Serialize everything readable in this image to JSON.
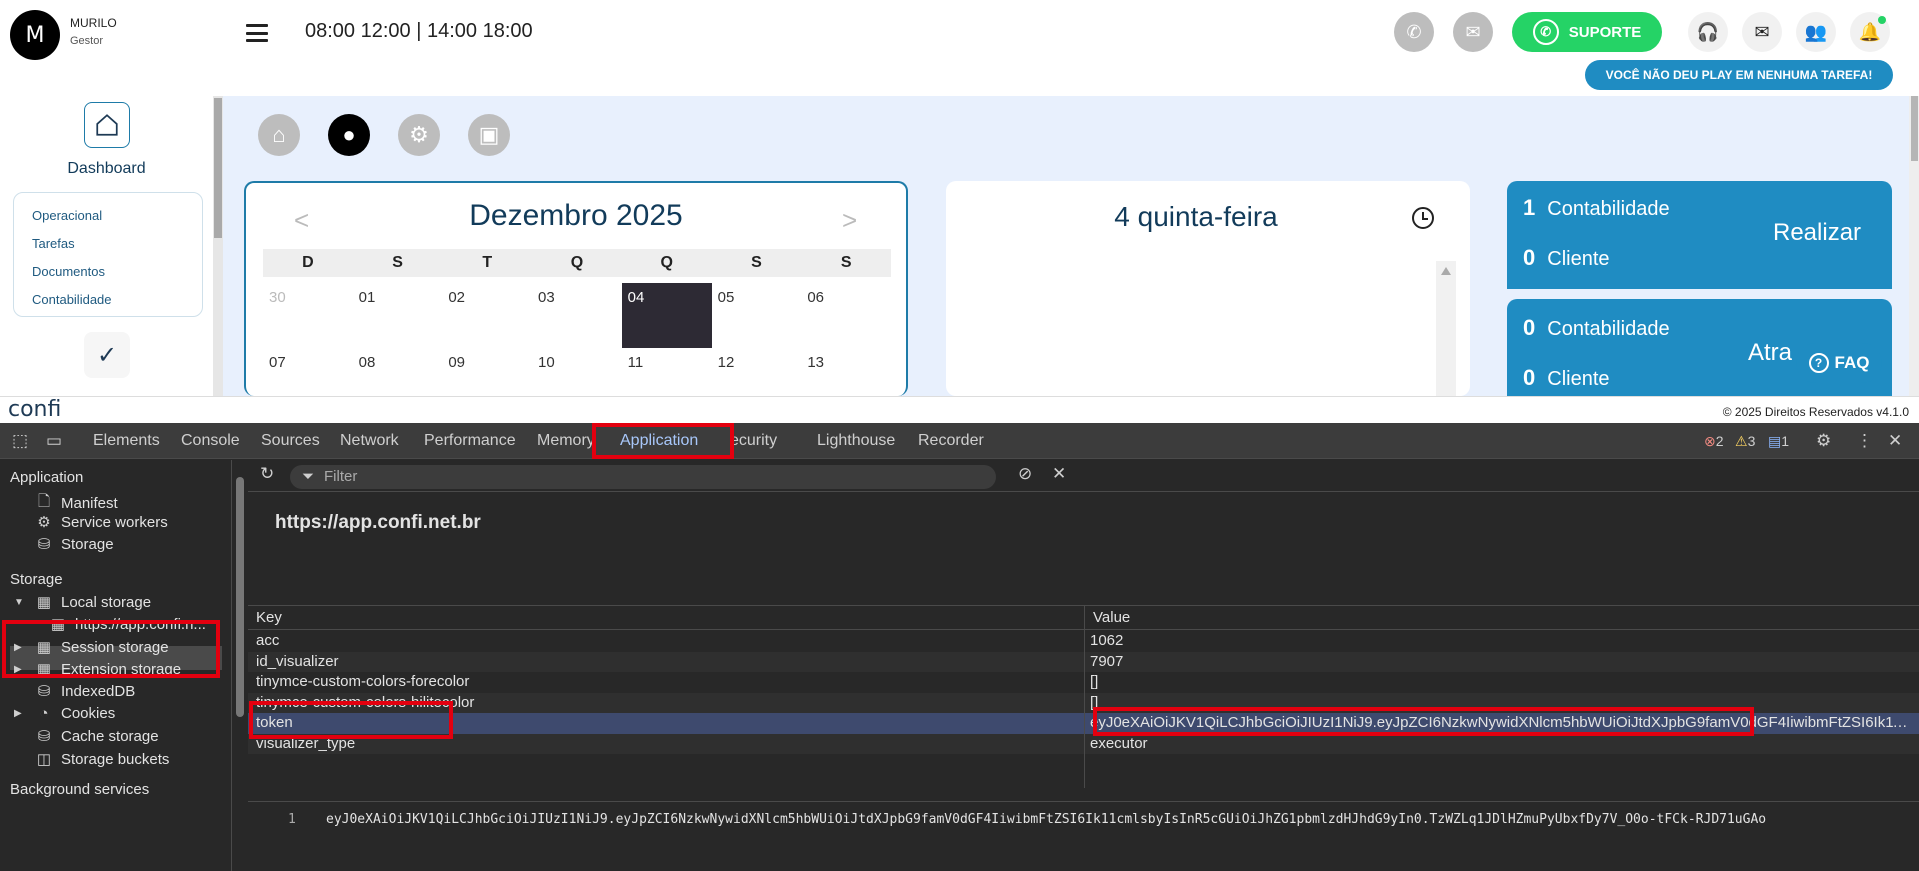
{
  "user": {
    "initial": "M",
    "name": "MURILO",
    "role": "Gestor"
  },
  "header": {
    "hours": "08:00 12:00 | 14:00 18:00",
    "support_label": "SUPORTE",
    "play_badge": "VOCÊ NÃO DEU PLAY EM NENHUMA TAREFA!"
  },
  "sidebar": {
    "dashboard_label": "Dashboard",
    "items": [
      "Operacional",
      "Tarefas",
      "Documentos",
      "Contabilidade"
    ]
  },
  "calendar": {
    "title": "Dezembro 2025",
    "prev": "<",
    "next": ">",
    "weekdays": [
      "D",
      "S",
      "T",
      "Q",
      "Q",
      "S",
      "S"
    ],
    "days": [
      {
        "n": "30",
        "other": true
      },
      {
        "n": "01"
      },
      {
        "n": "02"
      },
      {
        "n": "03"
      },
      {
        "n": "04",
        "selected": true
      },
      {
        "n": "05"
      },
      {
        "n": "06"
      },
      {
        "n": "07"
      },
      {
        "n": "08"
      },
      {
        "n": "09"
      },
      {
        "n": "10"
      },
      {
        "n": "11"
      },
      {
        "n": "12"
      },
      {
        "n": "13"
      }
    ]
  },
  "day": {
    "title": "4 quinta-feira"
  },
  "stats": {
    "realizar": {
      "label": "Realizar",
      "contabilidade_count": "1",
      "contabilidade_label": "Contabilidade",
      "cliente_count": "0",
      "cliente_label": "Cliente"
    },
    "atrasadas": {
      "label": "Atra",
      "contabilidade_count": "0",
      "contabilidade_label": "Contabilidade",
      "cliente_count": "0",
      "cliente_label": "Cliente"
    }
  },
  "faq_label": "FAQ",
  "footer": {
    "logo": "confi",
    "copyright": "© 2025 Direitos Reservados v4.1.0"
  },
  "devtools": {
    "tabs": [
      "Elements",
      "Console",
      "Sources",
      "Network",
      "Performance",
      "Memory",
      "Application",
      "ecurity",
      "Lighthouse",
      "Recorder"
    ],
    "active_tab": "Application",
    "errors": "2",
    "warnings": "3",
    "infos": "1",
    "sidebar": {
      "application_header": "Application",
      "application_items": [
        "Manifest",
        "Service workers",
        "Storage"
      ],
      "storage_header": "Storage",
      "local_storage": "Local storage",
      "local_storage_origin": "https://app.confi.n...",
      "storage_items": [
        "Session storage",
        "Extension storage",
        "IndexedDB",
        "Cookies",
        "Cache storage",
        "Storage buckets"
      ],
      "background_header": "Background services"
    },
    "filter_placeholder": "Filter",
    "origin": "https://app.confi.net.br",
    "table": {
      "key_header": "Key",
      "value_header": "Value",
      "rows": [
        {
          "key": "acc",
          "value": "1062"
        },
        {
          "key": "id_visualizer",
          "value": "7907"
        },
        {
          "key": "tinymce-custom-colors-forecolor",
          "value": "[]"
        },
        {
          "key": "tinymce-custom-colors-hilitecolor",
          "value": "[]"
        },
        {
          "key": "token",
          "value": "eyJ0eXAiOiJKV1QiLCJhbGciOiJIUzI1NiJ9.eyJpZCI6NzkwNywidXNlcm5hbWUiOiJtdXJpbG9famV0dGF4IiwibmFtZSI6Ik11cmlsb..."
        },
        {
          "key": "visualizer_type",
          "value": "executor"
        }
      ]
    },
    "preview": {
      "line": "1",
      "text": "eyJ0eXAiOiJKV1QiLCJhbGciOiJIUzI1NiJ9.eyJpZCI6NzkwNywidXNlcm5hbWUiOiJtdXJpbG9famV0dGF4IiwibmFtZSI6Ik11cmlsbyIsInR5cGUiOiJhZG1pbmlzdHJhdG9yIn0.TzWZLq1JDlHZmuPyUbxfDy7V_O0o-tFCk-RJD71uGAo"
    }
  }
}
